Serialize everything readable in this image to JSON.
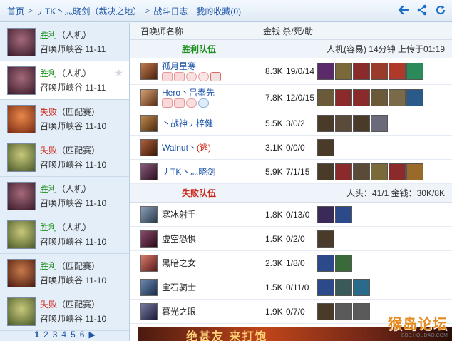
{
  "topbar": {
    "crumbs": [
      "首页",
      "丿TK丶灬晓剑（裁决之地）",
      "战斗日志"
    ],
    "favorites": "我的收藏(0)",
    "icons": [
      "back-arrow-icon",
      "share-icon",
      "refresh-icon"
    ]
  },
  "sidebar": {
    "matches": [
      {
        "result": "胜利",
        "mode": "（人机）",
        "map": "召唤师峡谷 11-11",
        "win": true,
        "avatar_color": "#5a3a4a"
      },
      {
        "result": "胜利",
        "mode": "（人机）",
        "map": "召唤师峡谷 11-11",
        "win": true,
        "avatar_color": "#5a3a4a"
      },
      {
        "result": "失败",
        "mode": "（匹配赛）",
        "map": "召唤师峡谷 11-10",
        "win": false,
        "avatar_color": "#b8421e"
      },
      {
        "result": "失败",
        "mode": "（匹配赛）",
        "map": "召唤师峡谷 11-10",
        "win": false,
        "avatar_color": "#7a8a3a"
      },
      {
        "result": "胜利",
        "mode": "（人机）",
        "map": "召唤师峡谷 11-10",
        "win": true,
        "avatar_color": "#5a3a4a"
      },
      {
        "result": "胜利",
        "mode": "（人机）",
        "map": "召唤师峡谷 11-10",
        "win": true,
        "avatar_color": "#7a8a3a"
      },
      {
        "result": "胜利",
        "mode": "（匹配赛）",
        "map": "召唤师峡谷 11-10",
        "win": true,
        "avatar_color": "#8a3a22"
      },
      {
        "result": "失败",
        "mode": "（匹配赛）",
        "map": "召唤师峡谷 11-10",
        "win": false,
        "avatar_color": "#7a8a3a"
      }
    ],
    "pages": [
      "1",
      "2",
      "3",
      "4",
      "5",
      "6",
      "▶"
    ]
  },
  "main": {
    "col_name": "召唤师名称",
    "col_stats": "金钱 杀/死/助",
    "win_team": {
      "label": "胜利队伍",
      "info": "人机(容易) 14分钟 上传于01:19"
    },
    "lose_team": {
      "label": "失败队伍",
      "info": "人头：41/1 金钱：30K/8K"
    },
    "win_players": [
      {
        "name": "孤月星寒",
        "tag": "",
        "gold": "8.3K",
        "kda": "19/0/14",
        "avatar": "#6a3a2a",
        "badges": true,
        "items": [
          "#5a2a6a",
          "#7a6a3a",
          "#8a2a2a",
          "#9a3a2a",
          "#b03a2a",
          "#2a8a5a"
        ]
      },
      {
        "name": "Hero丶吕奉先",
        "tag": "",
        "gold": "7.8K",
        "kda": "12/0/15",
        "avatar": "#8a5a3a",
        "badges": true,
        "items": [
          "#6a5a3a",
          "#8a2a2a",
          "#8a2a2a",
          "#6a5a3a",
          "#7a6a4a",
          "#2a5a8a"
        ]
      },
      {
        "name": "丶战神丿梓健",
        "tag": "",
        "gold": "5.5K",
        "kda": "3/0/2",
        "avatar": "#7a4a2a",
        "badges": false,
        "items": [
          "#4a3a2a",
          "#5a4a3a",
          "#4a3a2a",
          "#6a6a7a"
        ]
      },
      {
        "name": "Walnut丶",
        "tag": "(逃)",
        "gold": "3.1K",
        "kda": "0/0/0",
        "avatar": "#6a3a22",
        "badges": false,
        "items": [
          "#4a3a2a"
        ]
      },
      {
        "name": "丿TK丶灬晓剑",
        "tag": "",
        "gold": "5.9K",
        "kda": "7/1/15",
        "avatar": "#3a2a3a",
        "badges": false,
        "items": [
          "#4a3a2a",
          "#8a2a2a",
          "#5a4a3a",
          "#7a6a3a",
          "#8a2a2a",
          "#9a6a2a"
        ]
      }
    ],
    "lose_players": [
      {
        "name": "寒冰射手",
        "gold": "1.8K",
        "kda": "0/13/0",
        "avatar": "#4a5a6a",
        "items": [
          "#3a2a5a",
          "#2a4a8a"
        ]
      },
      {
        "name": "虚空恐惧",
        "gold": "1.5K",
        "kda": "0/2/0",
        "avatar": "#5a2a3a",
        "items": [
          "#4a3a2a"
        ]
      },
      {
        "name": "黑暗之女",
        "gold": "2.3K",
        "kda": "1/8/0",
        "avatar": "#8a3a3a",
        "items": [
          "#2a4a8a",
          "#3a6a3a"
        ]
      },
      {
        "name": "宝石骑士",
        "gold": "1.5K",
        "kda": "0/11/0",
        "avatar": "#3a4a6a",
        "items": [
          "#2a4a8a",
          "#3a5a5a",
          "#2a6a8a"
        ]
      },
      {
        "name": "暮光之眼",
        "gold": "1.9K",
        "kda": "0/7/0",
        "avatar": "#4a4a6a",
        "items": [
          "#4a3a2a",
          "#5a5a5a",
          "#5a5a5a"
        ]
      }
    ],
    "banner_text": "绝甚友 来打饱",
    "watermark": "猴岛论坛",
    "watermark_sub": "BBS.HOUDAO.COM"
  }
}
